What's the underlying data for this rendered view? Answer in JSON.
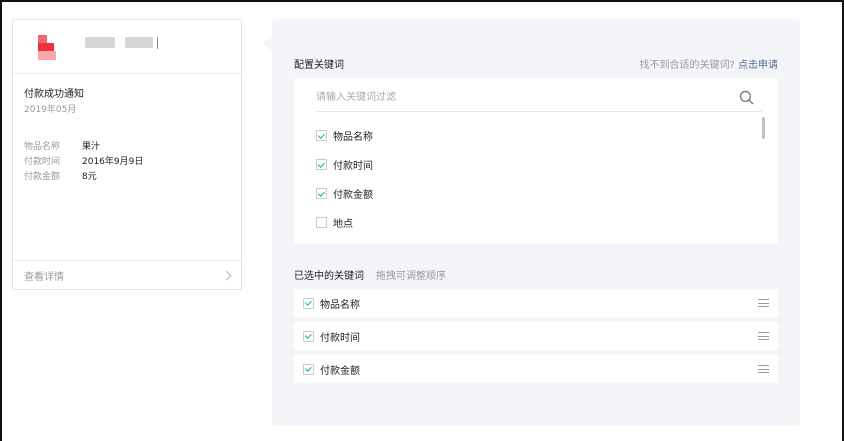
{
  "preview": {
    "title": "付款成功通知",
    "date": "2019年05月",
    "rows": [
      {
        "key": "物品名称",
        "value": "果汁"
      },
      {
        "key": "付款时间",
        "value": "2016年9月9日"
      },
      {
        "key": "付款金额",
        "value": "8元"
      }
    ],
    "detail_link": "查看详情",
    "logo_colors": [
      "#f4656e",
      "#f0303e",
      "#f7a8ad"
    ]
  },
  "config": {
    "title": "配置关键词",
    "help_text": "找不到合适的关键词?",
    "help_link": "点击申请",
    "search_placeholder": "请输入关键词过滤",
    "keywords": [
      {
        "label": "物品名称",
        "checked": true
      },
      {
        "label": "付款时间",
        "checked": true
      },
      {
        "label": "付款金额",
        "checked": true
      },
      {
        "label": "地点",
        "checked": false
      }
    ]
  },
  "selected": {
    "title": "已选中的关键词",
    "hint": "拖拽可调整顺序",
    "items": [
      {
        "label": "物品名称",
        "checked": true
      },
      {
        "label": "付款时间",
        "checked": true
      },
      {
        "label": "付款金额",
        "checked": true
      }
    ]
  },
  "colors": {
    "accent_green": "#07c160",
    "link_blue": "#576b95",
    "panel_bg": "#f4f5f9"
  }
}
